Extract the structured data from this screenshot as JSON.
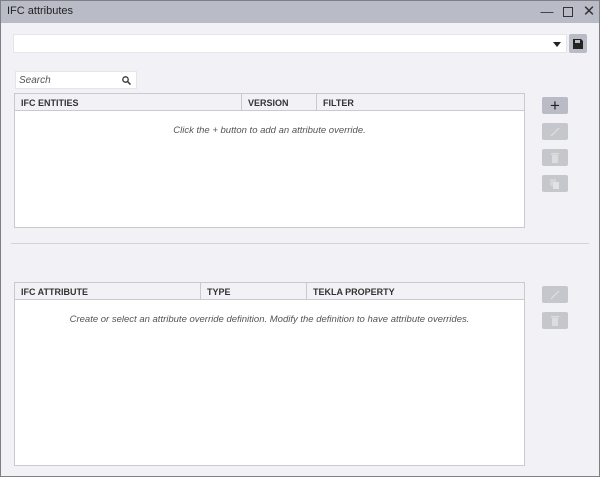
{
  "window": {
    "title": "IFC attributes"
  },
  "selector": {
    "value": ""
  },
  "search": {
    "placeholder": "Search"
  },
  "entities_table": {
    "columns": [
      "IFC ENTITIES",
      "VERSION",
      "FILTER"
    ],
    "empty_message": "Click the + button to add an attribute override."
  },
  "attributes_table": {
    "columns": [
      "IFC ATTRIBUTE",
      "TYPE",
      "TEKLA PROPERTY"
    ],
    "empty_message": "Create or select an attribute override definition. Modify the definition to have attribute overrides."
  }
}
